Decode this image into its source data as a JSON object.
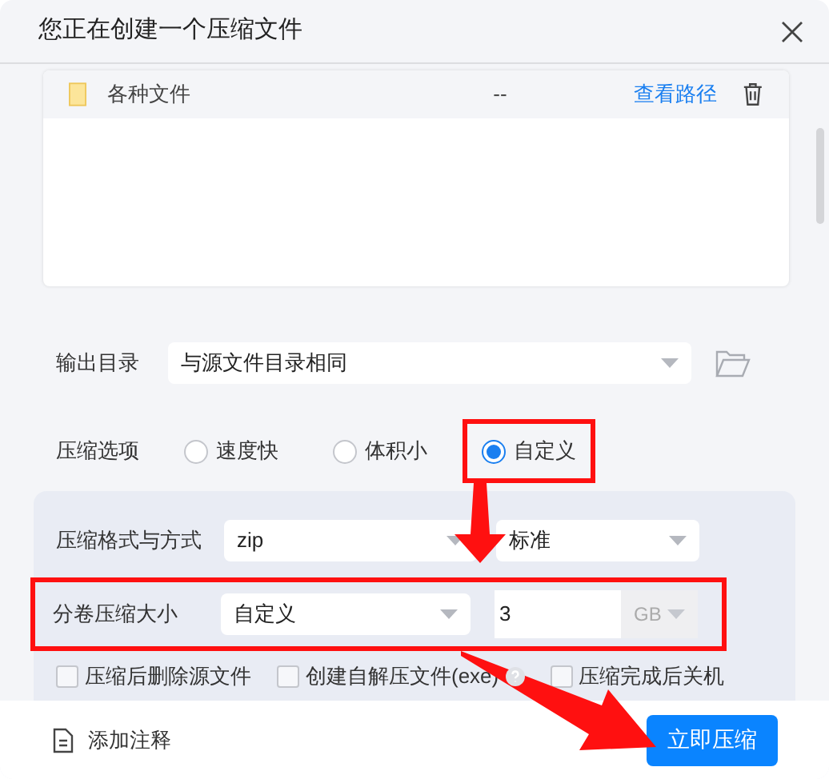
{
  "window": {
    "title": "您正在创建一个压缩文件"
  },
  "files": [
    {
      "name": "各种文件",
      "size": "--",
      "action": "查看路径"
    }
  ],
  "output_dir": {
    "label": "输出目录",
    "value": "与源文件目录相同"
  },
  "compression_options": {
    "label": "压缩选项",
    "options": [
      {
        "label": "速度快",
        "selected": false,
        "highlighted": false
      },
      {
        "label": "体积小",
        "selected": false,
        "highlighted": false
      },
      {
        "label": "自定义",
        "selected": true,
        "highlighted": true
      }
    ]
  },
  "format": {
    "label": "压缩格式与方式",
    "format": "zip",
    "method": "标准"
  },
  "split": {
    "label": "分卷压缩大小",
    "mode": "自定义",
    "size": "3",
    "unit": "GB",
    "highlighted": true
  },
  "checkboxes": [
    {
      "label": "压缩后删除源文件",
      "checked": false,
      "help": false
    },
    {
      "label": "创建自解压文件(exe)",
      "checked": false,
      "help": true
    },
    {
      "label": "压缩完成后关机",
      "checked": false,
      "help": false
    }
  ],
  "footer": {
    "note_button": "添加注释",
    "submit": "立即压缩"
  }
}
